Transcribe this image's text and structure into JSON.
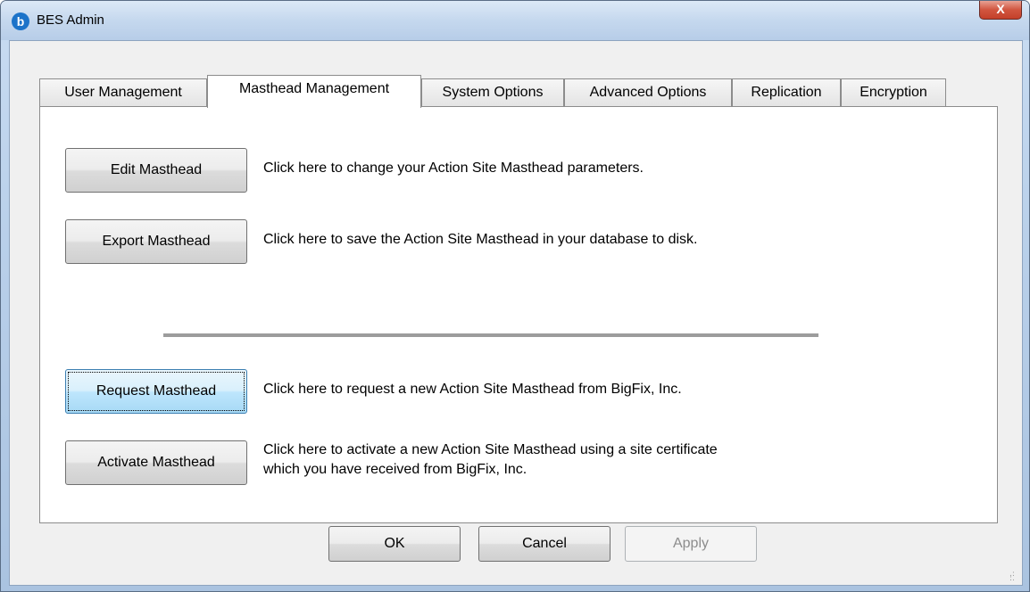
{
  "window": {
    "title": "BES Admin",
    "close_label": "X"
  },
  "tabs": [
    {
      "label": "User Management"
    },
    {
      "label": "Masthead Management"
    },
    {
      "label": "System Options"
    },
    {
      "label": "Advanced Options"
    },
    {
      "label": "Replication"
    },
    {
      "label": "Encryption"
    }
  ],
  "active_tab": "Masthead Management",
  "actions": [
    {
      "button": "Edit Masthead",
      "description": "Click here to change your Action Site Masthead parameters."
    },
    {
      "button": "Export Masthead",
      "description": "Click here to save the Action Site Masthead in your database to disk."
    },
    {
      "button": "Request Masthead",
      "description": "Click here to request a new Action Site Masthead from BigFix, Inc."
    },
    {
      "button": "Activate Masthead",
      "description_line1": "Click here to activate a new Action Site Masthead using a site certificate",
      "description_line2": "which you have received from BigFix, Inc."
    }
  ],
  "footer": {
    "ok_label": "OK",
    "cancel_label": "Cancel",
    "apply_label": "Apply"
  },
  "colors": {
    "titlebar": "#c5d8ee",
    "close_button": "#c4402a",
    "focused_button": "#bee6fd"
  }
}
